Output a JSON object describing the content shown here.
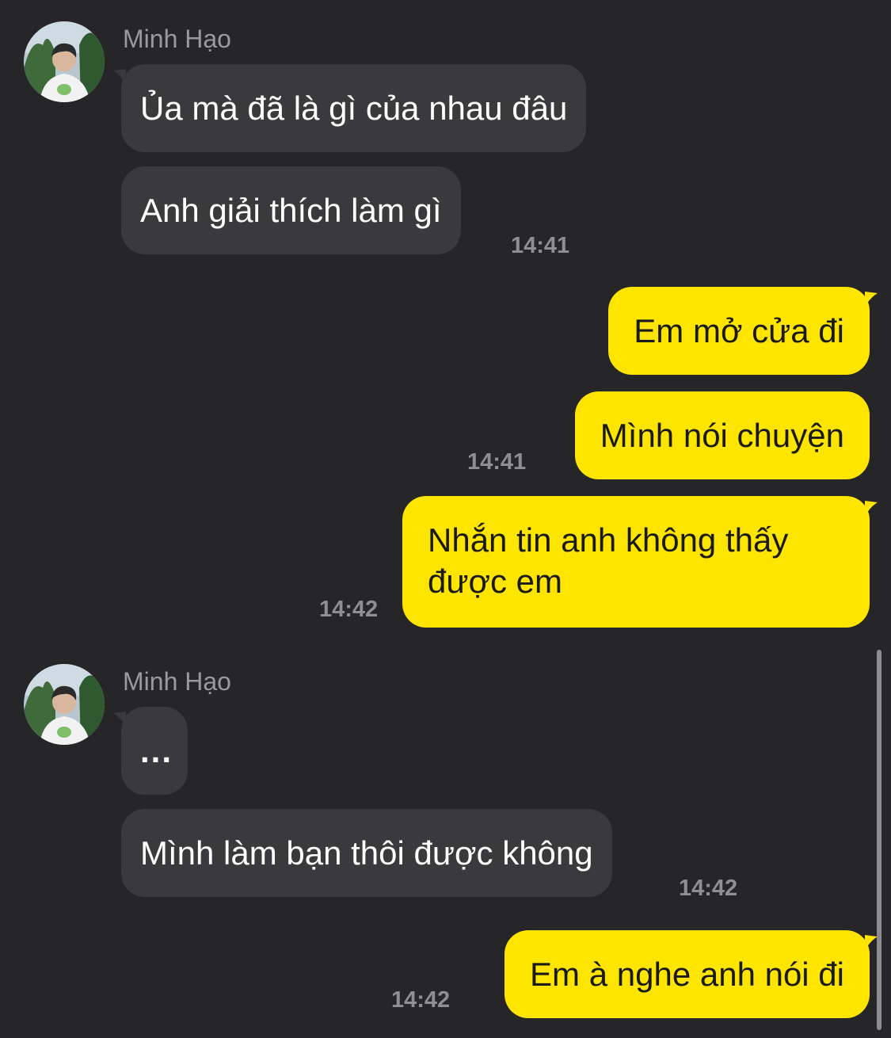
{
  "colors": {
    "background": "#262628",
    "incoming_bubble": "#3a3a3c",
    "outgoing_bubble": "#fee500",
    "incoming_text": "#ffffff",
    "outgoing_text": "#1a1a1a",
    "timestamp": "#8e8e93",
    "sender_name": "#9a9a9e"
  },
  "groups": [
    {
      "sender": "Minh Hạo",
      "avatar_icon": "profile-photo-icon",
      "messages": [
        "Ủa mà đã là gì của nhau đâu",
        "Anh giải thích làm gì"
      ],
      "time": "14:41"
    },
    {
      "sender": "me",
      "messages": [
        "Em mở cửa đi",
        "Mình nói chuyện"
      ],
      "time": "14:41"
    },
    {
      "sender": "me",
      "messages": [
        "Nhắn tin anh không thấy được em"
      ],
      "time": "14:42"
    },
    {
      "sender": "Minh Hạo",
      "avatar_icon": "profile-photo-icon",
      "messages": [
        "...",
        "Mình làm bạn thôi được không"
      ],
      "time": "14:42"
    },
    {
      "sender": "me",
      "messages": [
        "Em à nghe anh nói đi"
      ],
      "time": "14:42"
    }
  ]
}
